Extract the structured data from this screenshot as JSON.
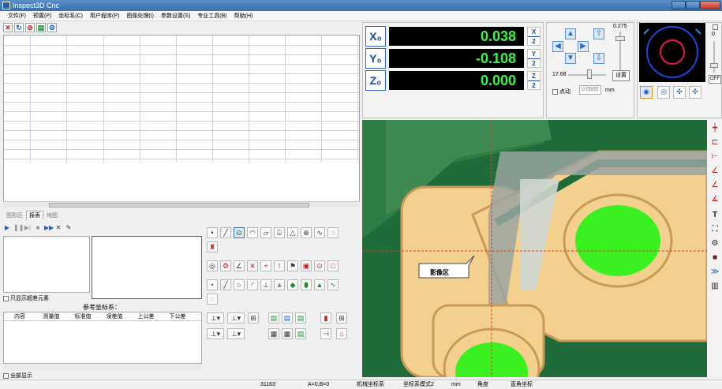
{
  "window": {
    "title": "Inspect3D Cnc"
  },
  "menu": [
    "文件(F)",
    "预置(P)",
    "坐标系(C)",
    "用户程序(P)",
    "图像处理(I)",
    "参数设置(S)",
    "专业工具(B)",
    "帮助(H)"
  ],
  "tabs": [
    "图形区",
    "报表",
    "地图"
  ],
  "left": {
    "only_exceed_label": "只显示超差元素",
    "ref_title": "参考坐标系：",
    "ref_columns": [
      "内容",
      "测量值",
      "标准值",
      "误差值",
      "上公差",
      "下公差"
    ],
    "all_show_label": "全部显示"
  },
  "dro": {
    "x": {
      "axis": "X₀",
      "value": "0.038",
      "half_top": "X",
      "half_bottom": "2"
    },
    "y": {
      "axis": "Y₀",
      "value": "-0.108",
      "half_top": "Y",
      "half_bottom": "2"
    },
    "z": {
      "axis": "Z₀",
      "value": "0.000",
      "half_top": "Z",
      "half_bottom": "2"
    }
  },
  "jog": {
    "speed_value": "0.275",
    "slider_value": "17.68",
    "set_label": "设置",
    "point_move_label": "点动",
    "step_value": "0.0500",
    "unit": "mm"
  },
  "nav": {
    "zero": "0",
    "off_label": "OFF"
  },
  "image": {
    "label": "影像区"
  },
  "status": {
    "coord": "31163",
    "ab": "A=0,B=0",
    "machine": "机械坐标系",
    "mode": "坐标系模式2",
    "unit": "mm",
    "angle": "角度",
    "rect": "直角坐标"
  },
  "colors": {
    "dro_text": "#3ef24a",
    "pad": "#f3d08e",
    "board": "#1f6b3a",
    "drill": "#3bf020"
  }
}
